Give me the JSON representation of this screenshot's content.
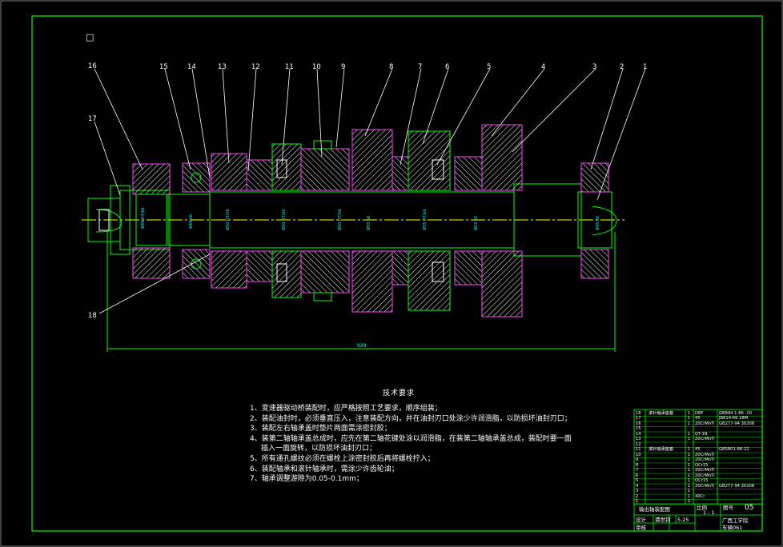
{
  "drawing": {
    "callouts": [
      "1",
      "2",
      "3",
      "4",
      "5",
      "6",
      "7",
      "8",
      "9",
      "10",
      "11",
      "12",
      "13",
      "14",
      "15",
      "16",
      "17",
      "18"
    ],
    "dimension_text": "929",
    "frame_mark": "□"
  },
  "tech_requirements": {
    "title": "技术要求",
    "lines": [
      "1、变速器驱动桥装配时，应严格按照工艺要求，顺序组装；",
      "2、装配油封时，必须垂直压入，注意装配方向，并在油封刃口处涂少许润滑脂，以防损坏油封刃口；",
      "3、装配左右轴承盖时垫片两面需涂密封胶；",
      "4、装第二轴轴承盖总成时，应先在第二轴花键处涂以润滑脂，在装第二轴轴承盖总成，装配时要一面",
      "插入一面旋转，以防损坏油封刃口；",
      "5、所有通孔螺纹必须在螺栓上涂密封胶后再将螺栓拧入；",
      "6、装配轴承和滚针轴承时，需涂少许齿轮油；",
      "7、轴承调整游隙为0.05-0.1mm；"
    ]
  },
  "title_block": {
    "rows": [
      {
        "no": "18",
        "name": "滚针轴承座套",
        "qty": "1",
        "std": "DBF",
        "remark": "GB894.1-86 -20"
      },
      {
        "no": "17",
        "name": "",
        "qty": "1",
        "std": "45",
        "remark": "JB814-66 18M"
      },
      {
        "no": "16",
        "name": "",
        "qty": "1",
        "std": "20CrMnTi",
        "remark": "GB277-94 30208"
      },
      {
        "no": "15",
        "name": "",
        "qty": "",
        "std": "",
        "remark": ""
      },
      {
        "no": "14",
        "name": "",
        "qty": "1",
        "std": "QT-1B",
        "remark": ""
      },
      {
        "no": "13",
        "name": "",
        "qty": "1",
        "std": "20CrMnTi",
        "remark": ""
      },
      {
        "no": "12",
        "name": "",
        "qty": "",
        "std": "",
        "remark": ""
      },
      {
        "no": "11",
        "name": "滚针轴承座套",
        "qty": "1",
        "std": "45",
        "remark": "GB5801-86-22"
      },
      {
        "no": "10",
        "name": "",
        "qty": "1",
        "std": "20CrMnTi",
        "remark": ""
      },
      {
        "no": "9",
        "name": "",
        "qty": "1",
        "std": "20CrMnTi",
        "remark": ""
      },
      {
        "no": "8",
        "name": "",
        "qty": "1",
        "std": "QCr15",
        "remark": ""
      },
      {
        "no": "7",
        "name": "",
        "qty": "1",
        "std": "20CrMnTi",
        "remark": ""
      },
      {
        "no": "6",
        "name": "",
        "qty": "1",
        "std": "20CrMnTi",
        "remark": ""
      },
      {
        "no": "5",
        "name": "",
        "qty": "1",
        "std": "QCr15",
        "remark": ""
      },
      {
        "no": "4",
        "name": "",
        "qty": "1",
        "std": "20CrMnTi",
        "remark": "GB277-94 30208"
      },
      {
        "no": "3",
        "name": "",
        "qty": "1",
        "std": "",
        "remark": ""
      },
      {
        "no": "2",
        "name": "",
        "qty": "1",
        "std": "40Cr",
        "remark": ""
      },
      {
        "no": "1",
        "name": "",
        "qty": "1",
        "std": "",
        "remark": ""
      }
    ],
    "assembly_name": "输出轴装配图",
    "scale": "1 : 1",
    "sheet": "05",
    "designer": "设计",
    "designer_name": "谭世钧",
    "date": "5.25",
    "checker": "审核",
    "approver": "批准",
    "org": "广西工学院",
    "class": "车辆061",
    "ratio_label": "比例",
    "count_label": "图号",
    "weight_label": "重量",
    "qty_label": "共",
    "sheet_label": "张"
  },
  "colors": {
    "background": "#000000",
    "outline": "#00ff00",
    "geometry": "#ff3fff",
    "hatch": "#ffffff",
    "centerline": "#ffff00",
    "cyan_text": "#00ffff",
    "text": "#ffffff"
  }
}
